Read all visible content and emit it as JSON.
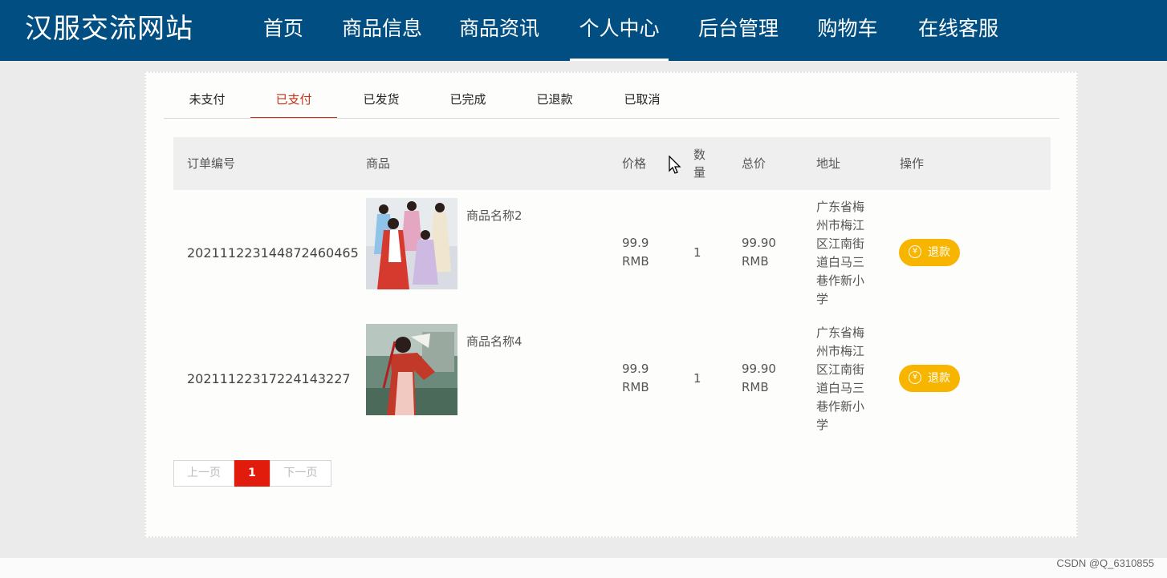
{
  "site": {
    "title": "汉服交流网站"
  },
  "nav": {
    "items": [
      {
        "label": "首页"
      },
      {
        "label": "商品信息"
      },
      {
        "label": "商品资讯"
      },
      {
        "label": "个人中心"
      },
      {
        "label": "后台管理"
      },
      {
        "label": "购物车"
      },
      {
        "label": "在线客服"
      }
    ],
    "active": "个人中心"
  },
  "tabs": {
    "items": [
      {
        "label": "未支付"
      },
      {
        "label": "已支付"
      },
      {
        "label": "已发货"
      },
      {
        "label": "已完成"
      },
      {
        "label": "已退款"
      },
      {
        "label": "已取消"
      }
    ],
    "active": "已支付"
  },
  "table": {
    "headers": [
      "订单编号",
      "商品",
      "价格",
      "数量",
      "总价",
      "地址",
      "操作"
    ],
    "rows": [
      {
        "order_no": "20211122314487246046​5",
        "product_name": "商品名称2",
        "price": "99.9 RMB",
        "qty": "1",
        "total": "99.90 RMB",
        "address": "广东省梅州市梅江区江南街道白马三巷作新小学",
        "action": "退款"
      },
      {
        "order_no": "20211122317224143227",
        "product_name": "商品名称4",
        "price": "99.9 RMB",
        "qty": "1",
        "total": "99.90 RMB",
        "address": "广东省梅州市梅江区江南街道白马三巷作新小学",
        "action": "退款"
      }
    ]
  },
  "pagination": {
    "prev": "上一页",
    "current": "1",
    "next": "下一页"
  },
  "watermark": "CSDN @Q_6310855",
  "colors": {
    "header": "#014f82",
    "active_tab": "#c0321a",
    "page_current": "#e21c0c",
    "refund_button": "#f7b500"
  },
  "icons": [
    "yen-icon",
    "cursor-icon"
  ]
}
